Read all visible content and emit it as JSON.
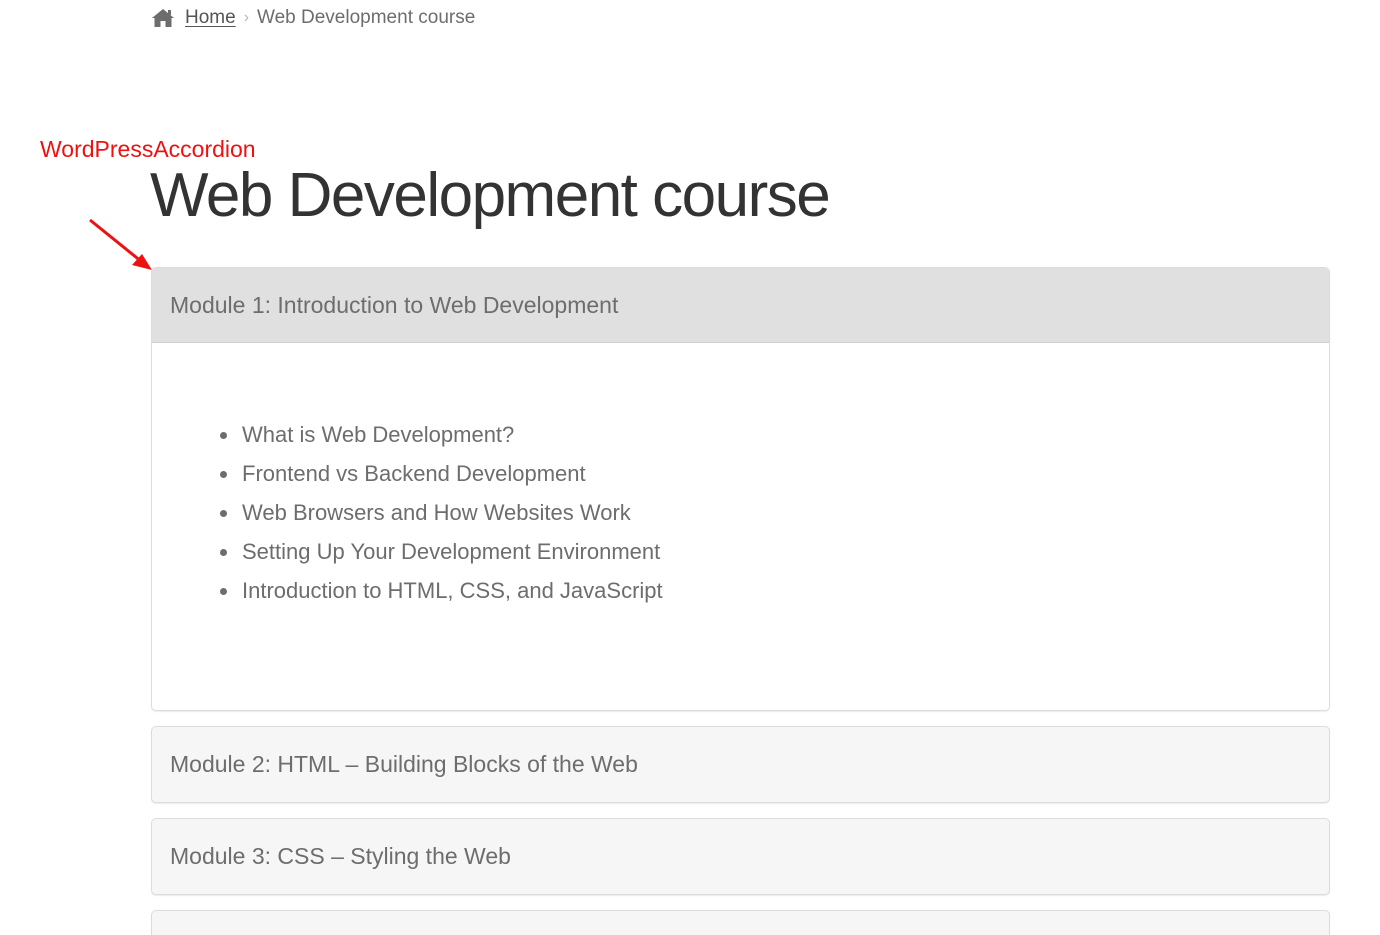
{
  "breadcrumb": {
    "home_label": "Home",
    "current_label": "Web Development course",
    "separator": "›",
    "home_icon": "home-icon"
  },
  "annotation": {
    "label": "WordPressAccordion",
    "color": "#ee1111"
  },
  "page": {
    "title": "Web Development course"
  },
  "accordion": {
    "items": [
      {
        "title": "Module 1: Introduction to Web Development",
        "expanded": true,
        "topics": [
          "What is Web Development?",
          "Frontend vs Backend Development",
          "Web Browsers and How Websites Work",
          "Setting Up Your Development Environment",
          "Introduction to HTML, CSS, and JavaScript"
        ]
      },
      {
        "title": "Module 2: HTML – Building Blocks of the Web",
        "expanded": false
      },
      {
        "title": "Module 3: CSS – Styling the Web",
        "expanded": false
      }
    ]
  },
  "colors": {
    "open_header_bg": "#e0e0e0",
    "closed_header_bg": "#f6f6f6",
    "text": "#6d6d6d",
    "title_text": "#333333"
  }
}
